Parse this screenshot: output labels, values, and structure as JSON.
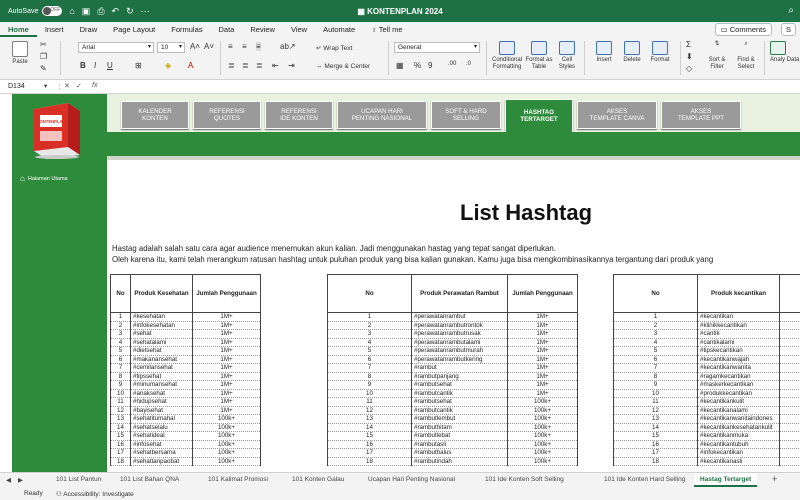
{
  "titlebar": {
    "autosave_label": "AutoSave",
    "autosave_state": "OFF",
    "doc_title": "KONTENPLAN 2024"
  },
  "ribbon_tabs": [
    "Home",
    "Insert",
    "Draw",
    "Page Layout",
    "Formulas",
    "Data",
    "Review",
    "View",
    "Automate"
  ],
  "tell_me": "Tell me",
  "comments_label": "Comments",
  "share_label": "S",
  "ribbon": {
    "paste": "Paste",
    "font_name": "Arial",
    "font_size": "10",
    "wrap_text": "Wrap Text",
    "merge_center": "Merge & Center",
    "number_format": "General",
    "conditional_formatting": "Conditional Formatting",
    "format_as_table": "Format as Table",
    "cell_styles": "Cell Styles",
    "insert": "Insert",
    "delete": "Delete",
    "format": "Format",
    "sort_filter": "Sort & Filter",
    "find_select": "Find & Select",
    "analyze_data": "Analy Data"
  },
  "formula_bar": {
    "cell_ref": "D134",
    "fx": "fx"
  },
  "sidebar": {
    "home_label": "Halaman Utama"
  },
  "product_box": {
    "brand": "KONTENPLAN"
  },
  "nav_buttons": [
    {
      "line1": "KALENDER",
      "line2": "KONTEN"
    },
    {
      "line1": "REFERENSI",
      "line2": "QUOTES"
    },
    {
      "line1": "REFERENSI",
      "line2": "IDE KONTEN"
    },
    {
      "line1": "UCAPAN HARI",
      "line2": "PENTING NASIONAL"
    },
    {
      "line1": "SOFT & HARD",
      "line2": "SELLING"
    },
    {
      "line1": "HASHTAG",
      "line2": "TERTARGET"
    },
    {
      "line1": "AKSES",
      "line2": "TEMPLATE CANVA"
    },
    {
      "line1": "AKSES",
      "line2": "TEMPLATE PPT"
    }
  ],
  "page_title": "List Hashtag",
  "description": [
    "Hastag adalah salah satu cara agar audience menemukan akun kalian. Jadi menggunakan hastag yang tepat sangat diperlukan.",
    "Oleh karena itu, kami telah merangkum ratusan hashtag untuk puluhan produk yang bisa kalian gunakan. Kamu juga bisa mengkombinasikannya tergantung dari produk yang"
  ],
  "tables": [
    {
      "headers": [
        "No",
        "Produk Kesehatan",
        "Jumlah Penggunaan"
      ],
      "rows": [
        [
          "1",
          "#kesehatan",
          "1M+"
        ],
        [
          "2",
          "#infokesehatan",
          "1M+"
        ],
        [
          "3",
          "#sehat",
          "1M+"
        ],
        [
          "4",
          "#sehatalami",
          "1M+"
        ],
        [
          "5",
          "#dietsehat",
          "1M+"
        ],
        [
          "6",
          "#makanansehat",
          "1M+"
        ],
        [
          "7",
          "#cemilansehat",
          "1M+"
        ],
        [
          "8",
          "#tipssehat",
          "1M+"
        ],
        [
          "9",
          "#minumansehat",
          "1M+"
        ],
        [
          "10",
          "#anaksehat",
          "1M+"
        ],
        [
          "11",
          "#hidupsehat",
          "1M+"
        ],
        [
          "12",
          "#bayisehat",
          "1M+"
        ],
        [
          "13",
          "#sehatitumahal",
          "100k+"
        ],
        [
          "14",
          "#sehatselalu",
          "100k+"
        ],
        [
          "15",
          "#sehatideal",
          "100k+"
        ],
        [
          "16",
          "#infosehat",
          "100k+"
        ],
        [
          "17",
          "#sehatbersama",
          "100k+"
        ],
        [
          "18",
          "#sehattanpaobat",
          "100k+"
        ]
      ]
    },
    {
      "headers": [
        "No",
        "Produk Perawatan Rambut",
        "Jumlah Penggunaan"
      ],
      "rows": [
        [
          "1",
          "#perawatanrambut",
          "1M+"
        ],
        [
          "2",
          "#perawatanrambutrontok",
          "1M+"
        ],
        [
          "3",
          "#perawatanrambutrusak",
          "1M+"
        ],
        [
          "4",
          "#perawatanrambutalami",
          "1M+"
        ],
        [
          "5",
          "#perawatanrambutmurah",
          "1M+"
        ],
        [
          "6",
          "#perawatanrambutkering",
          "1M+"
        ],
        [
          "7",
          "#rambut",
          "1M+"
        ],
        [
          "8",
          "#rambutpanjang",
          "1M+"
        ],
        [
          "9",
          "#rambutsehat",
          "1M+"
        ],
        [
          "10",
          "#rambutcantik",
          "1M+"
        ],
        [
          "11",
          "#rambutsehat",
          "100k+"
        ],
        [
          "12",
          "#rambutcantik",
          "100k+"
        ],
        [
          "13",
          "#rambutlembut",
          "100k+"
        ],
        [
          "14",
          "#rambuthitam",
          "100k+"
        ],
        [
          "15",
          "#rambutlebat",
          "100k+"
        ],
        [
          "16",
          "#rambutasli",
          "100k+"
        ],
        [
          "17",
          "#rambuthalus",
          "100k+"
        ],
        [
          "18",
          "#rambutindah",
          "100k+"
        ]
      ]
    },
    {
      "headers": [
        "No",
        "Produk kecantikan",
        ""
      ],
      "rows": [
        [
          "1",
          "#kecantikan",
          ""
        ],
        [
          "2",
          "#klinikkecantikan",
          ""
        ],
        [
          "3",
          "#cantik",
          ""
        ],
        [
          "4",
          "#cantikalami",
          ""
        ],
        [
          "5",
          "#tipskecantikan",
          ""
        ],
        [
          "6",
          "#kecantikanwajah",
          ""
        ],
        [
          "7",
          "#kecantikanwanita",
          ""
        ],
        [
          "8",
          "#ragamkecantikan",
          ""
        ],
        [
          "9",
          "#maskerkecantikan",
          ""
        ],
        [
          "10",
          "#produkkecantikan",
          ""
        ],
        [
          "11",
          "#kecantikankulit",
          ""
        ],
        [
          "12",
          "#kecantikanalami",
          ""
        ],
        [
          "13",
          "#kecantikanwanitaindones",
          ""
        ],
        [
          "14",
          "#kecantikankesehatankulit",
          ""
        ],
        [
          "15",
          "#kecantikanmuka",
          ""
        ],
        [
          "16",
          "#kecantikantubuh",
          ""
        ],
        [
          "17",
          "#infokecantikan",
          ""
        ],
        [
          "18",
          "#kecantikanasli",
          ""
        ]
      ]
    }
  ],
  "sheet_tabs": [
    "101 List Pantun",
    "101 List Bahan QNA",
    "101 Kalimat Promosi",
    "101 Konten Galau",
    "Ucapan Hari Penting Nasional",
    "101 Ide Konten Soft Selling",
    "101 Ide Konten Hard Selling",
    "Hastag Tertarget"
  ],
  "active_sheet": "Hastag Tertarget",
  "status": {
    "ready": "Ready",
    "accessibility": "Accessibility: Investigate"
  },
  "colors": {
    "excel_green": "#1e7145",
    "sheet_green": "#2e8b3c",
    "nav_gray": "#9a9a9a"
  }
}
